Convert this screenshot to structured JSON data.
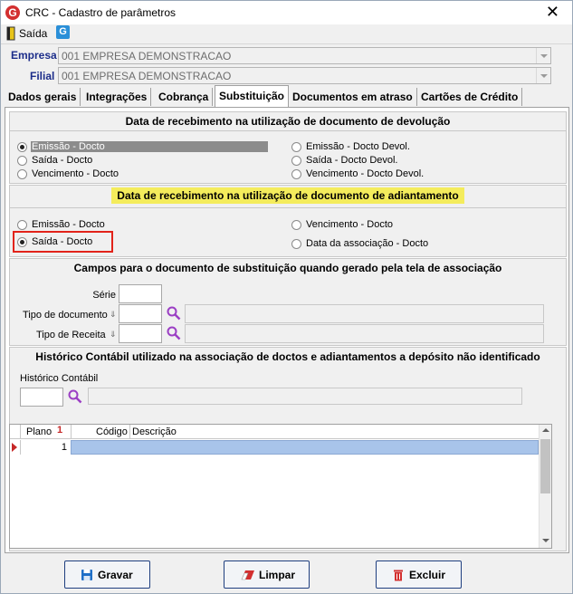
{
  "window": {
    "title": "CRC - Cadastro de parâmetros",
    "close_glyph": "✕"
  },
  "toolbar": {
    "exit_label": "Saída"
  },
  "header": {
    "empresa_label": "Empresa",
    "empresa_value": "001 EMPRESA DEMONSTRACAO",
    "filial_label": "Filial",
    "filial_value": "001 EMPRESA DEMONSTRACAO"
  },
  "tabs": [
    {
      "label": "Dados gerais"
    },
    {
      "label": "Integrações"
    },
    {
      "label": "Cobrança"
    },
    {
      "label": "Substituição"
    },
    {
      "label": "Documentos em atraso"
    },
    {
      "label": "Cartões de Crédito"
    }
  ],
  "group1": {
    "title": "Data de recebimento na utilização de documento de devolução",
    "options": [
      "Emissão - Docto",
      "Saída - Docto",
      "Vencimento - Docto",
      "Emissão - Docto Devol.",
      "Saída - Docto Devol.",
      "Vencimento - Docto Devol."
    ],
    "selected": "Emissão - Docto"
  },
  "group2": {
    "title": "Data de recebimento na utilização de documento de adiantamento",
    "options": [
      "Emissão - Docto",
      "Saída - Docto",
      "Vencimento - Docto",
      "Data da associação - Docto"
    ],
    "selected": "Saída - Docto"
  },
  "group3": {
    "title": "Campos para o documento de substituição quando gerado pela tela de associação",
    "serie_label": "Série",
    "serie_value": "",
    "tipo_doc_label": "Tipo de documento",
    "tipo_doc_value": "",
    "tipo_receita_label": "Tipo de Receita",
    "tipo_receita_value": ""
  },
  "group4": {
    "title": "Histórico Contábil utilizado na associação de doctos e adiantamentos a depósito não identificado",
    "historico_label": "Histórico Contábil",
    "historico_value": ""
  },
  "grid": {
    "columns": [
      "Plano",
      "Código",
      "Descrição"
    ],
    "sort_badge": "1",
    "rows": [
      {
        "plano": "1",
        "codigo": "",
        "descricao": ""
      }
    ]
  },
  "buttons": {
    "save": "Gravar",
    "clear": "Limpar",
    "delete": "Excluir"
  },
  "colors": {
    "accent": "#1c2d8a",
    "highlight": "#f4ec5c",
    "callout": "#e2231a",
    "row_selected": "#a8c4ea"
  }
}
